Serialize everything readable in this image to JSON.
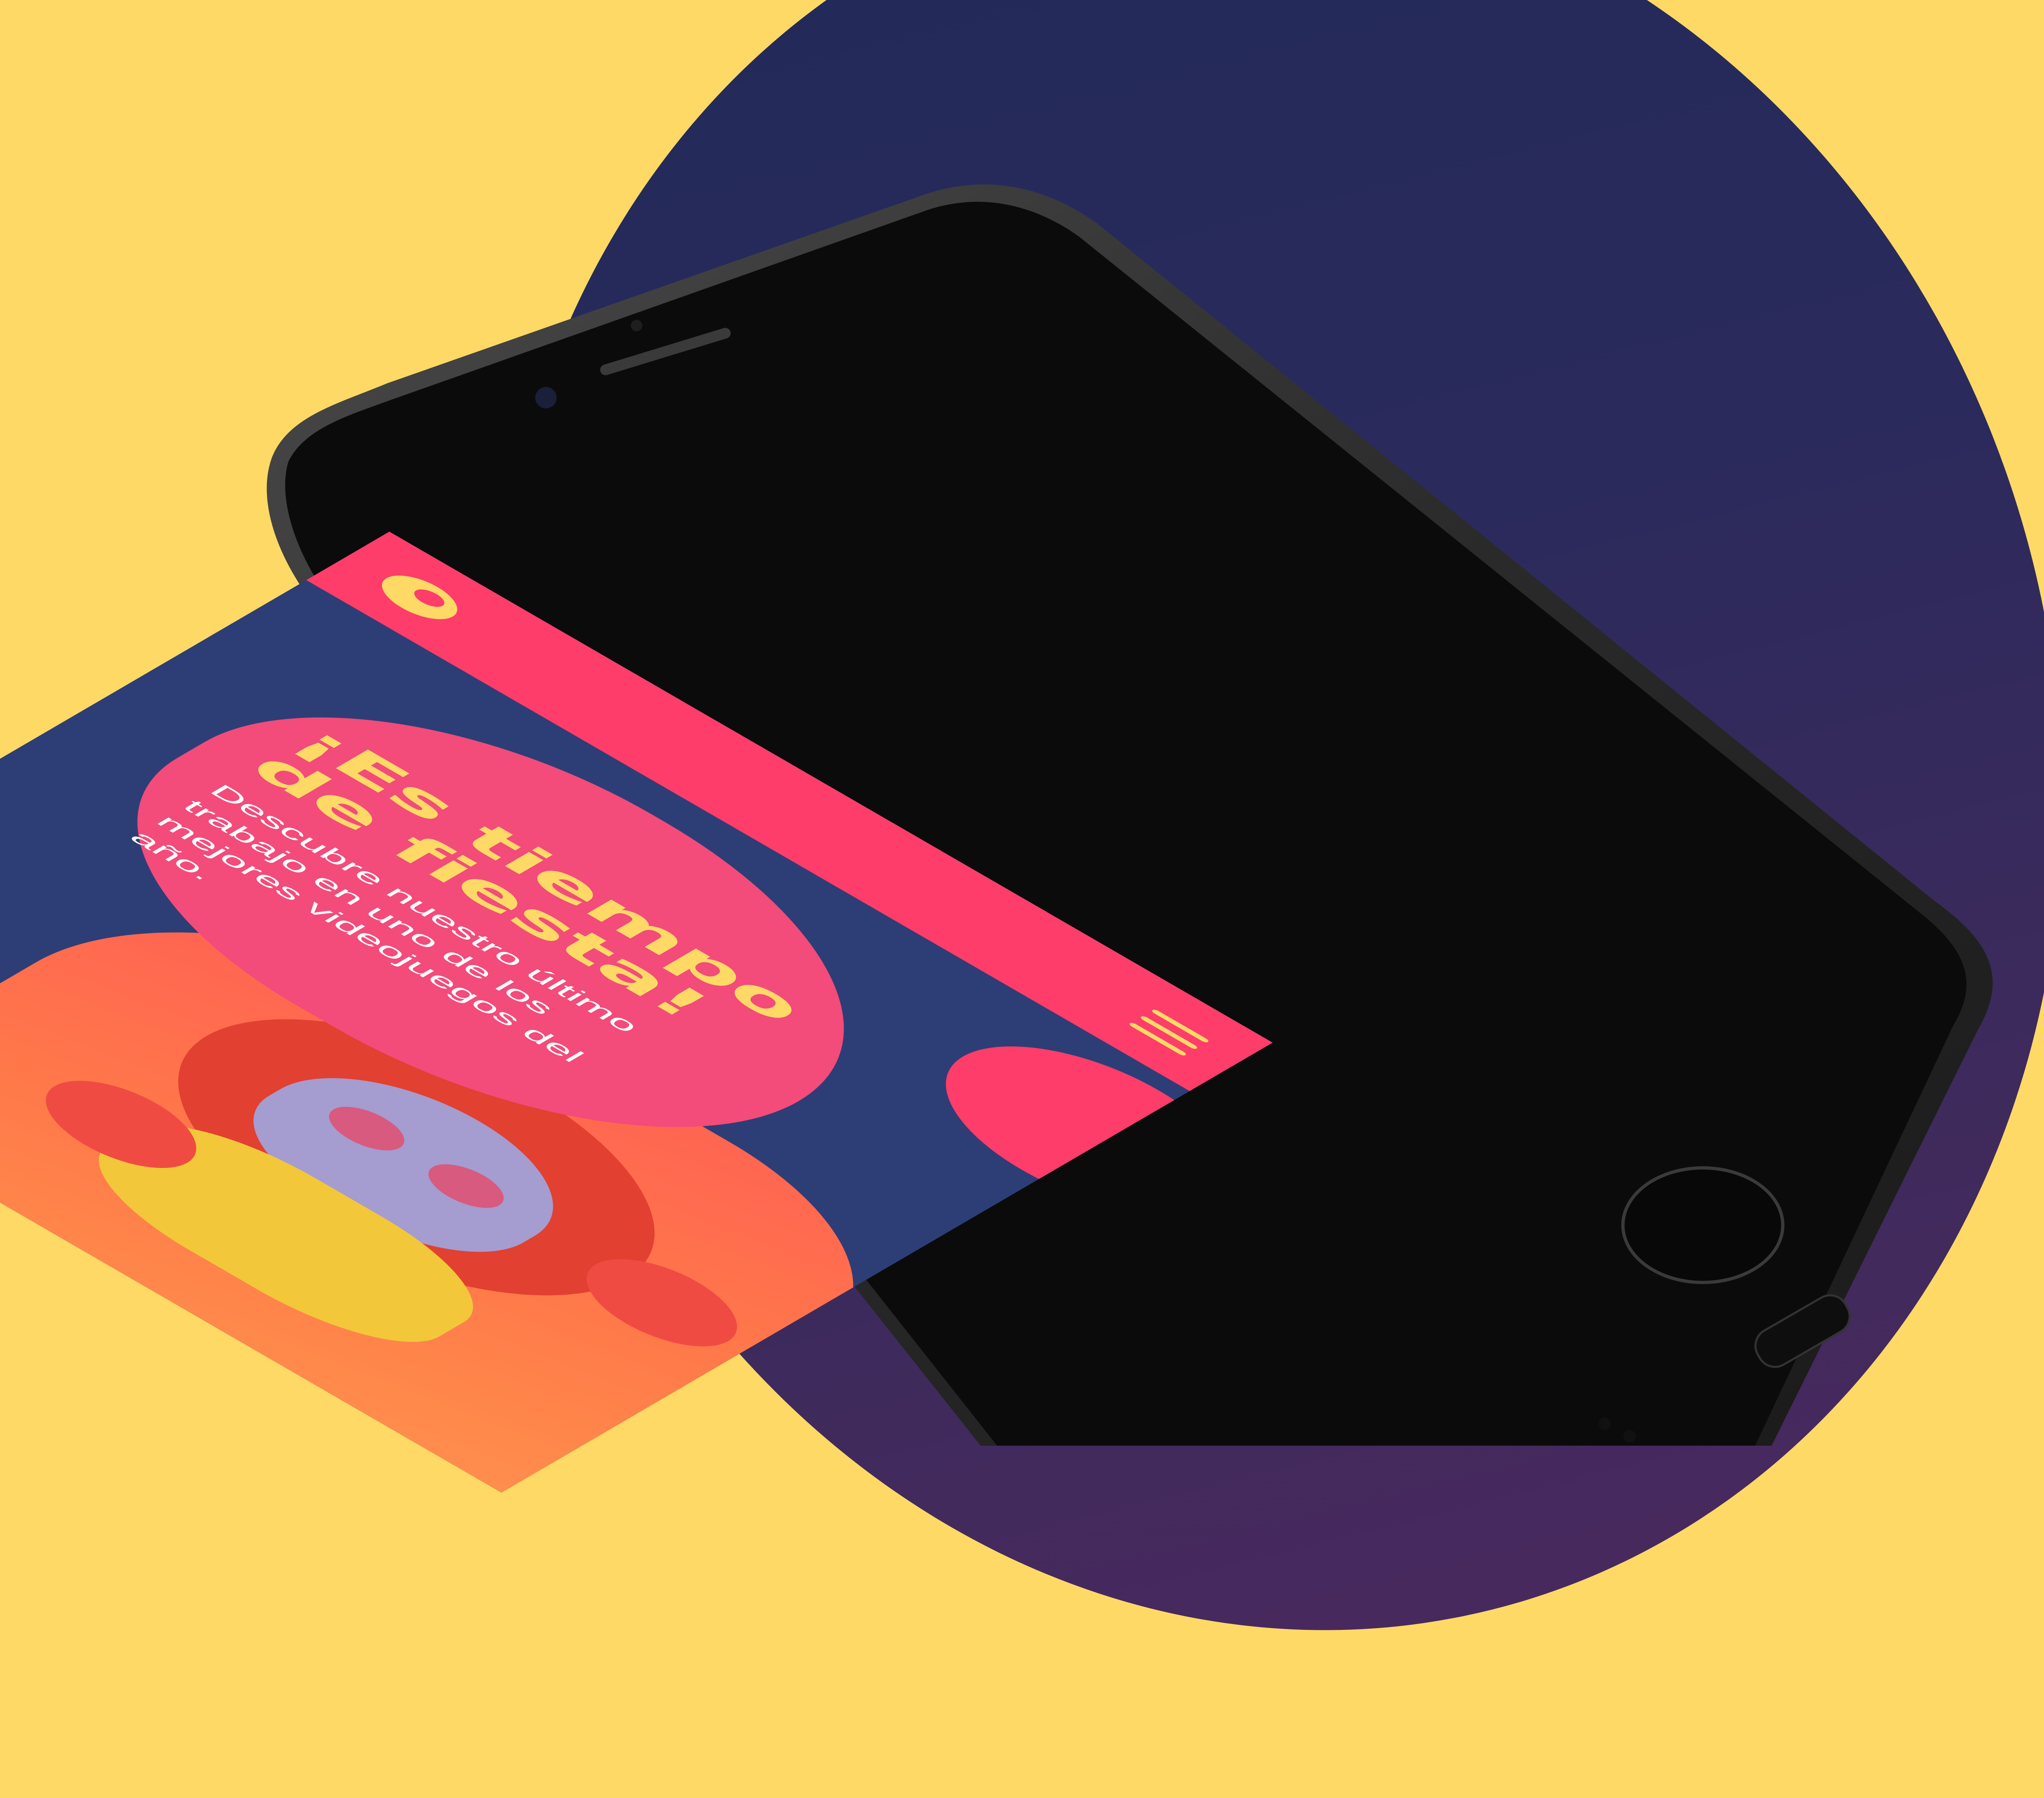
{
  "colors": {
    "background": "#fed966",
    "blob": "#2b2a5c",
    "accent_pink": "#fe3d6a",
    "accent_yellow": "#fed966",
    "screen_navy": "#2c3e75"
  },
  "header": {
    "logo_icon": "logo-icon",
    "menu_icon": "hamburger-menu-icon"
  },
  "hero": {
    "title": "¡Es tiempo de fiesta!",
    "description": "Descubre nuestro último trabajo en uno de los mejores videojuegos del año.",
    "image_subject": "skull-mariachi-game-character-icon"
  }
}
